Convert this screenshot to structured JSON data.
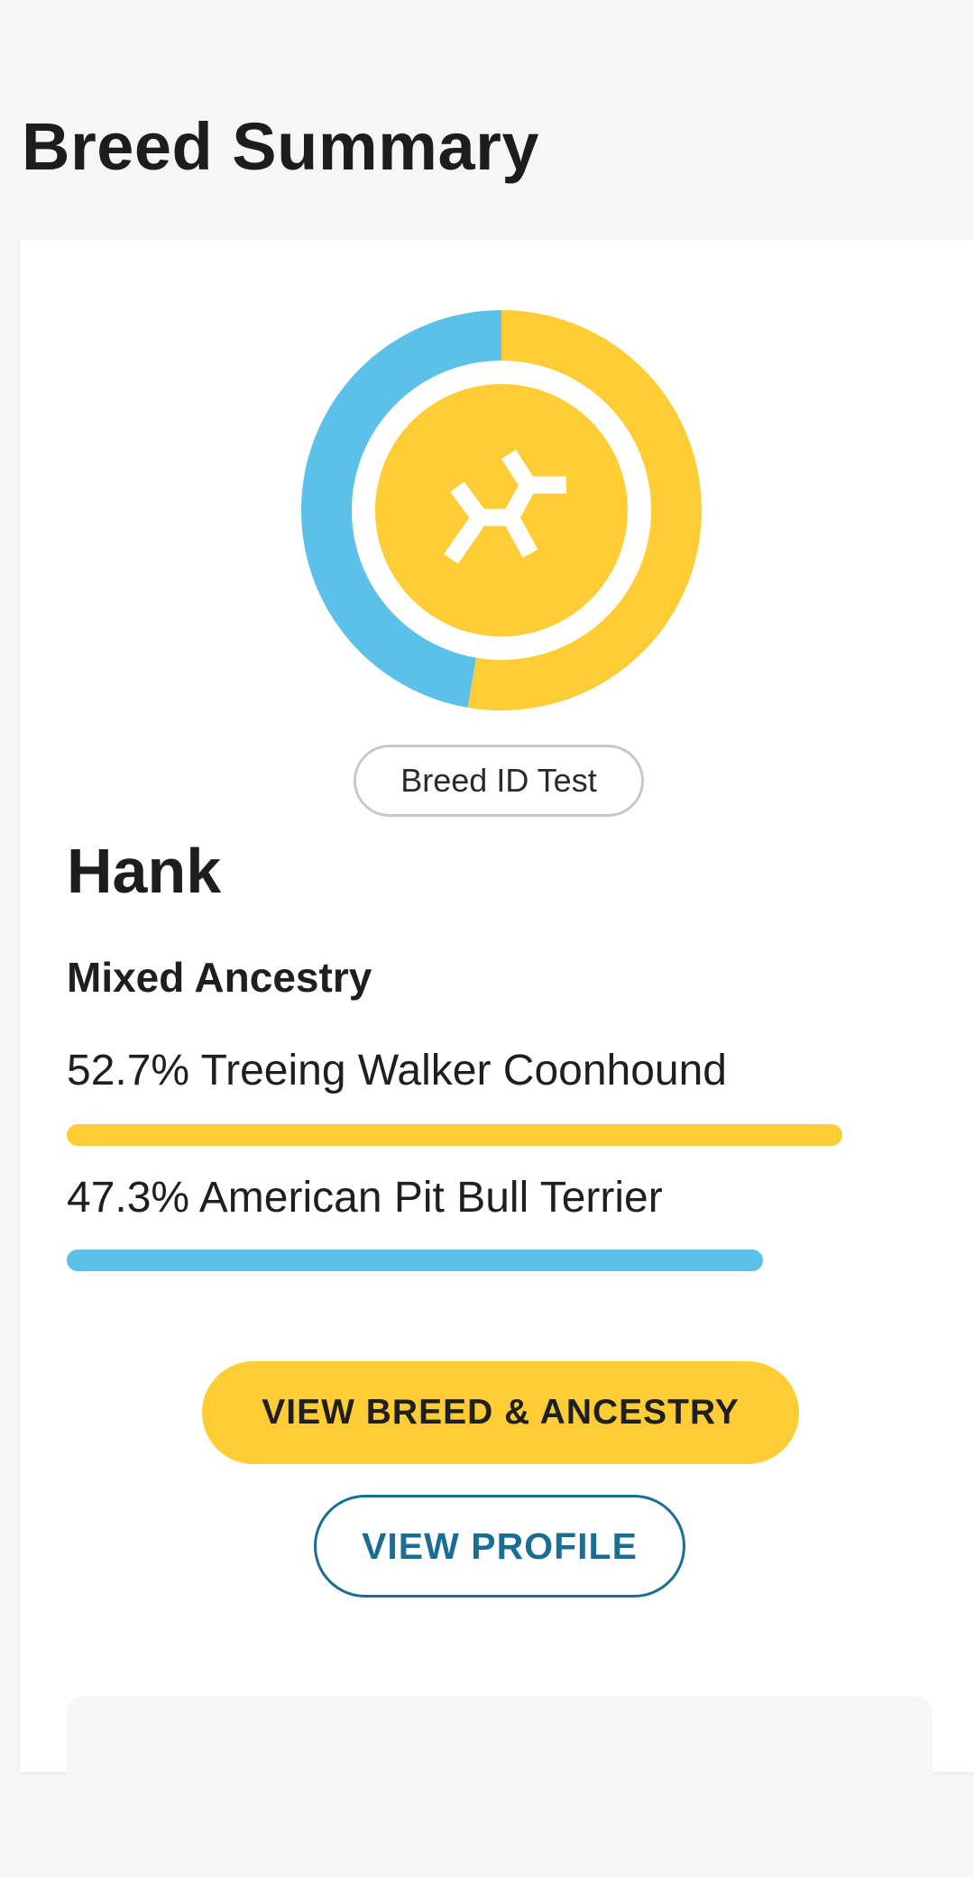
{
  "page": {
    "title": "Breed Summary"
  },
  "card": {
    "test_badge": "Breed ID Test",
    "dog_name": "Hank",
    "ancestry_heading": "Mixed Ancestry",
    "breeds": [
      {
        "percent": 52.7,
        "label": "52.7% Treeing Walker Coonhound",
        "color": "#fecd35"
      },
      {
        "percent": 47.3,
        "label": "47.3% American Pit Bull Terrier",
        "color": "#5bc1e8"
      }
    ],
    "primary_button": "VIEW BREED & ANCESTRY",
    "secondary_button": "VIEW PROFILE"
  },
  "icons": {
    "breed_ring": "breed-donut-ring",
    "logo": "embark-logo-icon"
  },
  "colors": {
    "accent_yellow": "#fecd35",
    "accent_blue": "#5bc1e8",
    "link_blue": "#1b6e93"
  }
}
